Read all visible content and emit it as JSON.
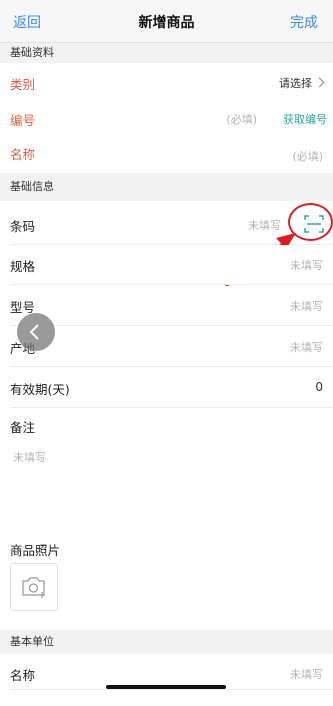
{
  "nav": {
    "back_label": "返回",
    "title": "新增商品",
    "done_label": "完成"
  },
  "sections": {
    "basic_data": "基础资料",
    "basic_info": "基础信息",
    "base_unit": "基本单位"
  },
  "fields": {
    "category": {
      "label": "类别",
      "value": "请选择"
    },
    "code": {
      "label": "编号",
      "placeholder": "(必填)",
      "action": "获取编号"
    },
    "name": {
      "label": "名称",
      "placeholder": "(必填)"
    },
    "barcode": {
      "label": "条码",
      "placeholder": "未填写"
    },
    "spec": {
      "label": "规格",
      "placeholder": "未填写"
    },
    "model": {
      "label": "型号",
      "placeholder": "未填写"
    },
    "origin": {
      "label": "产地",
      "placeholder": "未填写"
    },
    "shelf_life": {
      "label": "有效期(天)",
      "value": "0"
    },
    "memo": {
      "label": "备注",
      "placeholder": "未填写"
    },
    "photo": {
      "label": "商品照片"
    },
    "unit_name": {
      "label": "名称",
      "placeholder": "未填写"
    }
  },
  "colors": {
    "accent": "#3a8cf2",
    "required_label": "#e05c3c",
    "teal_action": "#2eaa9a",
    "annotation_red": "#e01b1b"
  },
  "icons": {
    "scan": "scan-barcode-icon",
    "camera": "camera-add-icon",
    "float_back": "chevron-left-icon"
  }
}
